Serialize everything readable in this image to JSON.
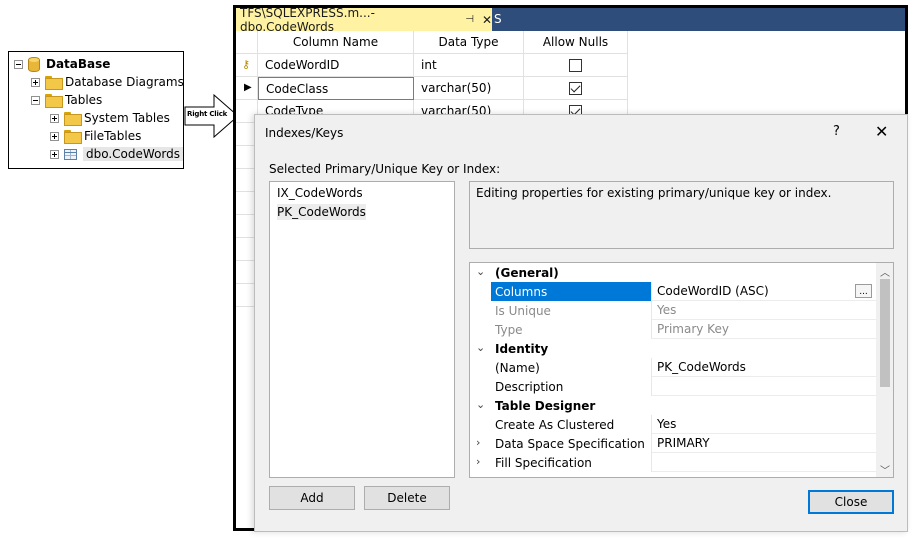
{
  "tree": {
    "items": [
      {
        "label": "DataBase",
        "bold": true
      },
      {
        "label": "Database Diagrams"
      },
      {
        "label": "Tables"
      },
      {
        "label": "System Tables"
      },
      {
        "label": "FileTables"
      },
      {
        "label": "dbo.CodeWords",
        "selected": true
      }
    ]
  },
  "arrow": {
    "label": "Right Click"
  },
  "ssms": {
    "tab_title": "TFS\\SQLEXPRESS.m...- dbo.CodeWords",
    "tab2_text": "S",
    "grid": {
      "headers": [
        "Column Name",
        "Data Type",
        "Allow Nulls"
      ],
      "rows": [
        {
          "name": "CodeWordID",
          "type": "int",
          "allow_nulls": false,
          "key": true
        },
        {
          "name": "CodeClass",
          "type": "varchar(50)",
          "allow_nulls": true,
          "current": true
        },
        {
          "name": "CodeType",
          "type": "varchar(50)",
          "allow_nulls": true
        }
      ]
    }
  },
  "dialog": {
    "title": "Indexes/Keys",
    "help": "?",
    "close_glyph": "✕",
    "list_label": "Selected Primary/Unique Key or Index:",
    "keys": [
      "IX_CodeWords",
      "PK_CodeWords"
    ],
    "selected_key": "PK_CodeWords",
    "description": "Editing properties for existing primary/unique key or index.",
    "properties": [
      {
        "name": "(General)",
        "category": true
      },
      {
        "name": "Columns",
        "value": "CodeWordID (ASC)",
        "selected": true,
        "ellipsis": "..."
      },
      {
        "name": "Is Unique",
        "value": "Yes",
        "dim": true
      },
      {
        "name": "Type",
        "value": "Primary Key",
        "dim": true
      },
      {
        "name": "Identity",
        "category": true
      },
      {
        "name": "(Name)",
        "value": "PK_CodeWords"
      },
      {
        "name": "Description",
        "value": ""
      },
      {
        "name": "Table Designer",
        "category": true
      },
      {
        "name": "Create As Clustered",
        "value": "Yes"
      },
      {
        "name": "Data Space Specification",
        "value": "PRIMARY",
        "expandable": true
      },
      {
        "name": "Fill Specification",
        "value": "",
        "expandable": true
      }
    ],
    "buttons": {
      "add": "Add",
      "delete": "Delete",
      "close": "Close"
    }
  },
  "colors": {
    "tab_active": "#fff3a3",
    "tabstrip": "#2e4d7b",
    "selection": "#0078d7"
  }
}
